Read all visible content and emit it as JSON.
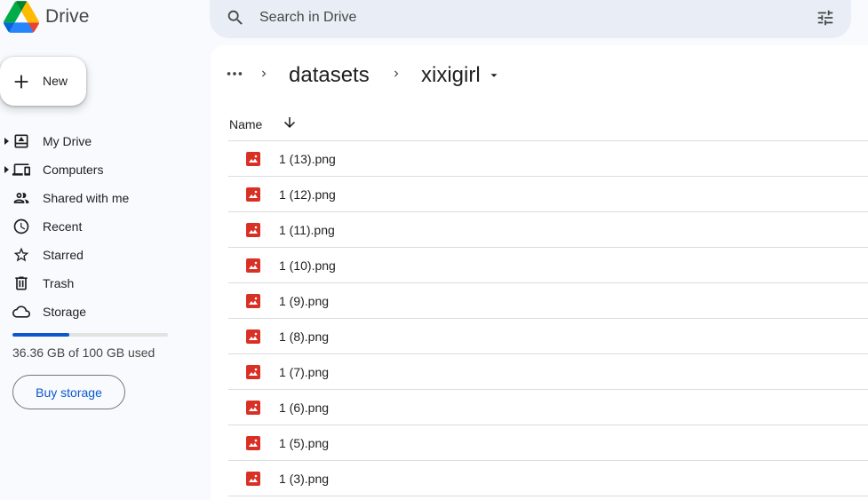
{
  "app": {
    "name": "Drive"
  },
  "search": {
    "placeholder": "Search in Drive"
  },
  "sidebar": {
    "new_label": "New",
    "items": [
      {
        "label": "My Drive",
        "icon": "my-drive-icon",
        "expandable": true
      },
      {
        "label": "Computers",
        "icon": "computers-icon",
        "expandable": true
      },
      {
        "label": "Shared with me",
        "icon": "people-icon",
        "expandable": false
      },
      {
        "label": "Recent",
        "icon": "clock-icon",
        "expandable": false
      },
      {
        "label": "Starred",
        "icon": "star-icon",
        "expandable": false
      },
      {
        "label": "Trash",
        "icon": "trash-icon",
        "expandable": false
      },
      {
        "label": "Storage",
        "icon": "cloud-icon",
        "expandable": false
      }
    ],
    "storage": {
      "used_fraction": 0.3636,
      "text": "36.36 GB of 100 GB used"
    },
    "buy_storage_label": "Buy storage"
  },
  "breadcrumb": {
    "parent": "datasets",
    "current": "xixigirl"
  },
  "list": {
    "column_name": "Name",
    "sort": "descending",
    "files": [
      {
        "name": "1 (13).png",
        "type": "image"
      },
      {
        "name": "1 (12).png",
        "type": "image"
      },
      {
        "name": "1 (11).png",
        "type": "image"
      },
      {
        "name": "1 (10).png",
        "type": "image"
      },
      {
        "name": "1 (9).png",
        "type": "image"
      },
      {
        "name": "1 (8).png",
        "type": "image"
      },
      {
        "name": "1 (7).png",
        "type": "image"
      },
      {
        "name": "1 (6).png",
        "type": "image"
      },
      {
        "name": "1 (5).png",
        "type": "image"
      },
      {
        "name": "1 (3).png",
        "type": "image"
      }
    ]
  },
  "colors": {
    "accent": "#0b57d0",
    "image_icon": "#d93025",
    "background": "#f8fafd",
    "search_bg": "#e9eef6"
  }
}
